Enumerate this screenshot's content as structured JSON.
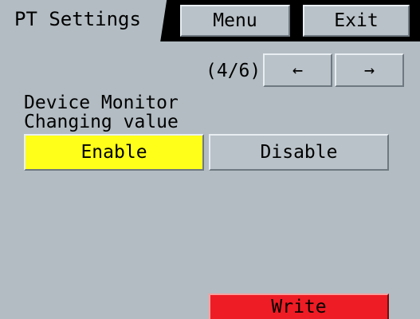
{
  "header": {
    "title": "PT Settings",
    "menu_label": "Menu",
    "exit_label": "Exit"
  },
  "pagination": {
    "indicator": "(4/6)",
    "prev_label": "←",
    "next_label": "→"
  },
  "setting": {
    "label_line1": "Device Monitor",
    "label_line2": "Changing value",
    "options": [
      {
        "label": "Enable",
        "selected": true
      },
      {
        "label": "Disable",
        "selected": false
      }
    ]
  },
  "write_label": "Write",
  "colors": {
    "background": "#b2bcc2",
    "selected": "#ffff19",
    "unselected": "#b9c2c8",
    "write": "#ee1c24"
  }
}
